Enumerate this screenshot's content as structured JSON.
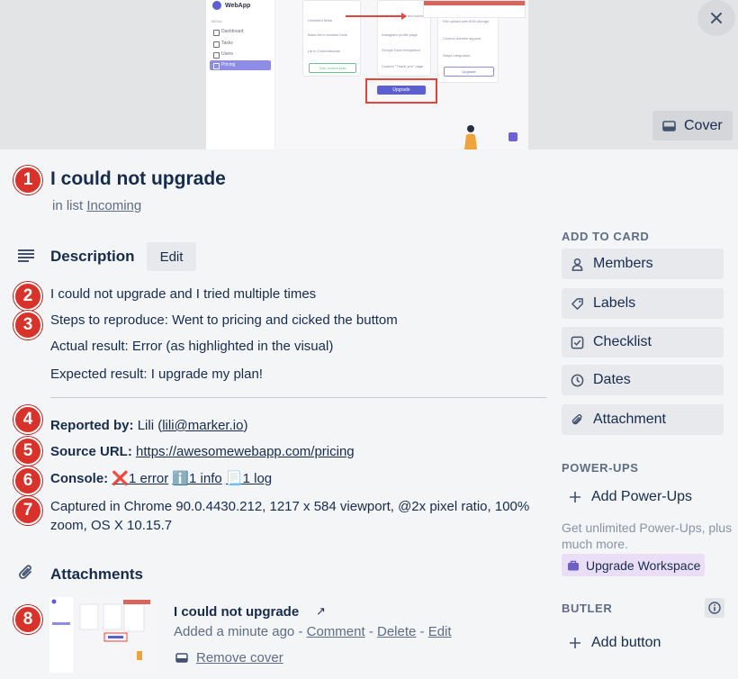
{
  "cover": {
    "app_name": "WebApp",
    "menu_label": "MENU",
    "nav_items": [
      "Dashboard",
      "Tasks",
      "Users",
      "Pricing"
    ],
    "plan_features_col1": [
      "Unlimited fields",
      "Basic form creation tools",
      "Up to 2 submissions"
    ],
    "plan_features_col2": [
      "Unlimited forms and surveys",
      "Instagram profile page",
      "Google Docs integration",
      "Custom \"Thank you\" page"
    ],
    "plan_features_col3": [
      "File upload with 5GB storage",
      "Custom domain support",
      "Stripe integration"
    ],
    "current_plan_label": "Your current plan",
    "upgrade_label": "Upgrade",
    "cover_button_label": "Cover"
  },
  "card": {
    "title": "I could not upgrade",
    "list_prefix": "in list",
    "list_name": "Incoming"
  },
  "markers": [
    "1",
    "2",
    "3",
    "4",
    "5",
    "6",
    "7",
    "8"
  ],
  "description": {
    "heading": "Description",
    "edit_label": "Edit",
    "lines": [
      "I could not upgrade and I tried multiple times",
      "Steps to reproduce: Went to pricing and cicked the buttom",
      "Actual result: Error (as highlighted in the visual)",
      "Expected result: I upgrade my plan!"
    ]
  },
  "meta": {
    "reported_by_label": "Reported by:",
    "reporter_name": "Lili",
    "reporter_email": "lili@marker.io",
    "source_url_label": "Source URL:",
    "source_url": "https://awesomewebapp.com/pricing",
    "console_label": "Console:",
    "console_error": "❌1 error",
    "console_info": "ℹ️1 info",
    "console_log": "📃1 log",
    "captured": "Captured in Chrome 90.0.4430.212, 1217 x 584 viewport, @2x pixel ratio, 100% zoom, OS X 10.15.7"
  },
  "attachments": {
    "heading": "Attachments",
    "name": "I could not upgrade",
    "open_icon": "↗",
    "added": "Added a minute ago",
    "sep": "-",
    "comment": "Comment",
    "delete": "Delete",
    "edit": "Edit",
    "remove_cover": "Remove cover"
  },
  "sidebar": {
    "add_to_card": "ADD TO CARD",
    "members": "Members",
    "labels": "Labels",
    "checklist": "Checklist",
    "dates": "Dates",
    "attachment": "Attachment",
    "power_ups": "POWER-UPS",
    "add_power_ups": "Add Power-Ups",
    "power_ups_note": "Get unlimited Power-Ups, plus much more.",
    "upgrade_workspace": "Upgrade Workspace",
    "butler": "BUTLER",
    "add_button": "Add button"
  },
  "colors": {
    "marker_red": "#d9322a",
    "text": "#172b4d",
    "muted": "#5e6c84",
    "button_bg": "#e8e9ec",
    "upgrade_purple": "#e9def5"
  }
}
